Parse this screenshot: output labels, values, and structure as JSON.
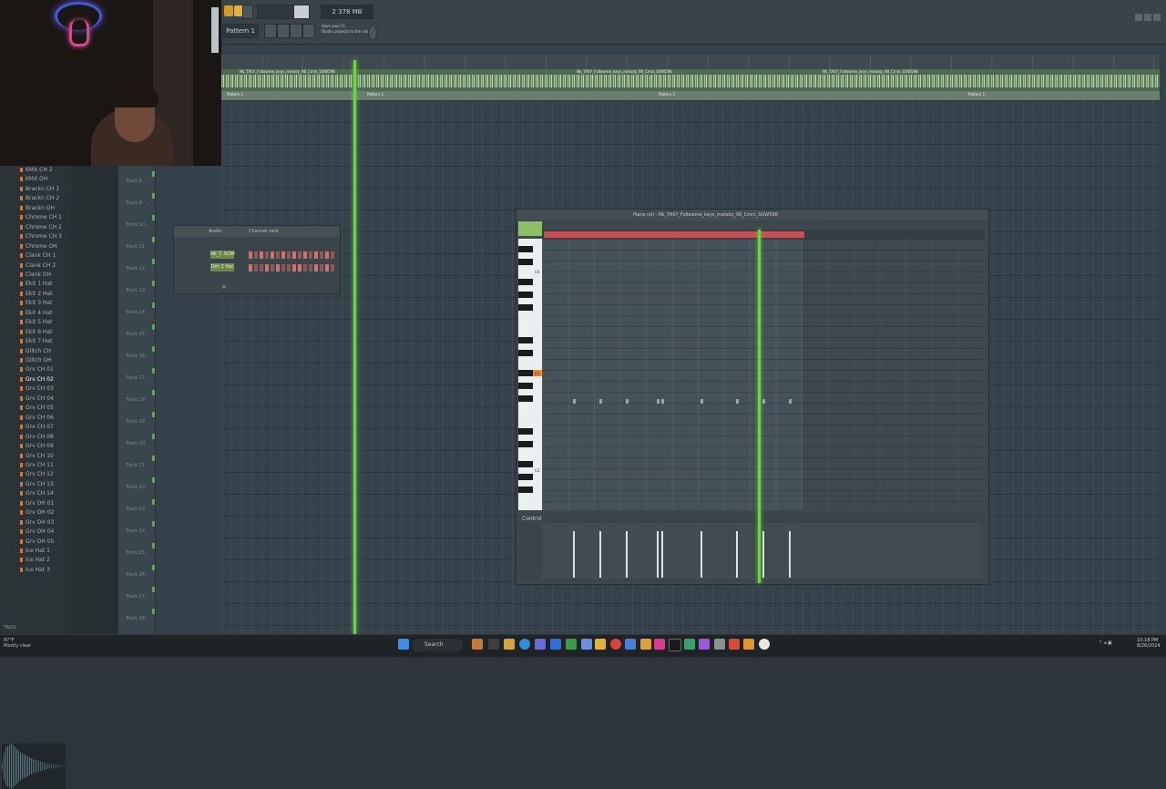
{
  "toolbar": {
    "pattern_label": "Pattern 1",
    "hint_line1": "Save your FL",
    "hint_line2": "Studio projects to the cloud",
    "tempo": "2",
    "tempo_unit": "378 MB"
  },
  "playlist": {
    "clip_name": "Nk_TASY_Followme_keys_melody_98_Cmin_SOW598",
    "pattern_clip": "Pattern 1",
    "track_label": "Track",
    "tracks": [
      "Track 8",
      "Track 9",
      "Track 10",
      "Track 11",
      "Track 12",
      "Track 13",
      "Track 14",
      "Track 15",
      "Track 16",
      "Track 17",
      "Track 18",
      "Track 19",
      "Track 20",
      "Track 21",
      "Track 22",
      "Track 23",
      "Track 24",
      "Track 25",
      "Track 26",
      "Track 27",
      "Track 28"
    ]
  },
  "browser": {
    "items": [
      "KMX CH 2",
      "KMX OH",
      "Brackn CH 1",
      "Brackn CH 2",
      "Brackn OH",
      "Chrome CH 1",
      "Chrome CH 2",
      "Chrome CH 3",
      "Chrome OH",
      "Clank CH 1",
      "Clank CH 2",
      "Clank OH",
      "Ekit 1 Hat",
      "Ekit 2 Hat",
      "Ekit 3 Hat",
      "Ekit 4 Hat",
      "Ekit 5 Hat",
      "Ekit 6 Hat",
      "Ekit 7 Hat",
      "Glitch CH",
      "Glitch OH",
      "Grv CH 01",
      "Grv CH 02",
      "Grv CH 03",
      "Grv CH 04",
      "Grv CH 05",
      "Grv CH 06",
      "Grv CH 07",
      "Grv CH 08",
      "Grv CH 09",
      "Grv CH 10",
      "Grv CH 11",
      "Grv CH 12",
      "Grv CH 13",
      "Grv CH 14",
      "Grv OH 01",
      "Grv OH 02",
      "Grv OH 03",
      "Grv OH 04",
      "Grv OH 05",
      "Ice Hat 1",
      "Ice Hat 2",
      "Ice Hat 3"
    ],
    "selected": "Grv CH 02",
    "footer": "TAGS"
  },
  "channel_rack": {
    "title": "Channel rack",
    "filter": "Audio",
    "channels": [
      {
        "name": "Nk_T..SOW",
        "steps": [
          1,
          0,
          1,
          0,
          1,
          0,
          1,
          0,
          1,
          0,
          1,
          0,
          1,
          0,
          1,
          0
        ]
      },
      {
        "name": "Dirt 2 Hat",
        "steps": [
          1,
          0,
          0,
          1,
          0,
          1,
          0,
          0,
          1,
          1,
          0,
          0,
          1,
          0,
          1,
          0
        ]
      }
    ],
    "add_label": "+"
  },
  "piano_roll": {
    "title": "Piano roll - Nk_TASY_Followme_keys_melody_98_Cmin_SOW598",
    "key_labels": [
      "C6",
      "C5",
      "C4"
    ],
    "control_label": "Control",
    "loop_fraction": 0.59,
    "playhead_fraction": 0.49,
    "notes_fraction": [
      0.07,
      0.13,
      0.19,
      0.26,
      0.27,
      0.36,
      0.44,
      0.5,
      0.56
    ],
    "velocities": [
      0.85,
      0.85,
      0.85,
      0.85,
      0.85,
      0.85,
      0.85,
      0.85,
      0.85
    ]
  },
  "taskbar": {
    "search": "Search",
    "weather_temp": "87°F",
    "weather_desc": "Mostly clear",
    "time": "10:18 PM",
    "date": "8/26/2024"
  },
  "colors": {
    "accent_green": "#6fd04d",
    "loop_red": "#c45158",
    "panel": "#3d484d",
    "fl_orange": "#d99a28"
  }
}
